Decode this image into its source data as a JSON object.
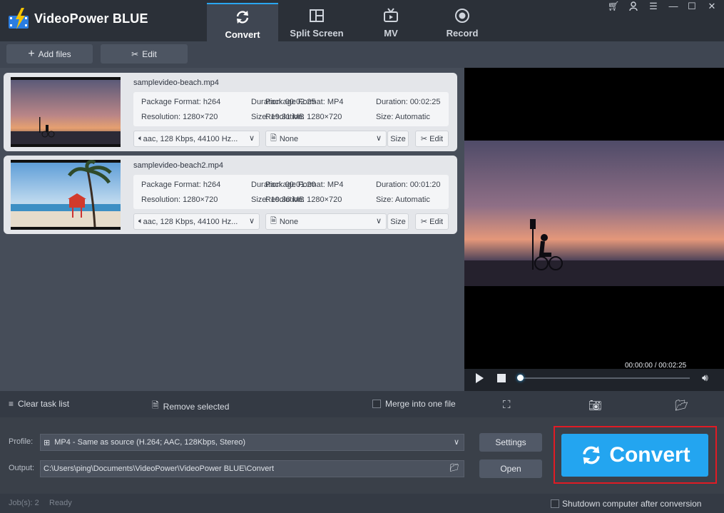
{
  "app": {
    "title": "VideoPower BLUE"
  },
  "tabs": [
    {
      "label": "Convert",
      "icon": "refresh-icon",
      "active": true
    },
    {
      "label": "Split Screen",
      "icon": "split-screen-icon",
      "active": false
    },
    {
      "label": "MV",
      "icon": "tv-icon",
      "active": false
    },
    {
      "label": "Record",
      "icon": "record-icon",
      "active": false
    }
  ],
  "toolbar": {
    "add_files": "Add files",
    "edit": "Edit"
  },
  "files": [
    {
      "name": "samplevideo-beach.mp4",
      "package_format": "Package Format: h264",
      "duration_overlap": "Duration: 00:02:25",
      "output_format": "Package Format: MP4",
      "duration": "Duration: 00:02:25",
      "resolution": "Resolution: 1280×720",
      "size_overlap": "Size: 19.31 MB",
      "output_resolution": "Resolution: 1280×720",
      "size": "Size: Automatic",
      "audio": "aac, 128 Kbps, 44100 Hz...",
      "subtitle": "None",
      "size_btn": "Size",
      "edit_btn": "Edit"
    },
    {
      "name": "samplevideo-beach2.mp4",
      "package_format": "Package Format: h264",
      "duration_overlap": "Duration: 00:01:20",
      "output_format": "Package Format: MP4",
      "duration": "Duration: 00:01:20",
      "resolution": "Resolution: 1280×720",
      "size_overlap": "Size: 10.36 MB",
      "output_resolution": "Resolution: 1280×720",
      "size": "Size: Automatic",
      "audio": "aac, 128 Kbps, 44100 Hz...",
      "subtitle": "None",
      "size_btn": "Size",
      "edit_btn": "Edit"
    }
  ],
  "player": {
    "time": "00:00:00 / 00:02:25",
    "progress": 0.0
  },
  "strip": {
    "clear": "Clear task list",
    "remove": "Remove selected",
    "merge": "Merge into one file"
  },
  "profile": {
    "label": "Profile:",
    "value": "MP4 - Same as source (H.264; AAC, 128Kbps, Stereo)",
    "settings": "Settings"
  },
  "output": {
    "label": "Output:",
    "value": "C:\\Users\\ping\\Documents\\VideoPower\\VideoPower BLUE\\Convert",
    "open": "Open"
  },
  "convert": {
    "label": "Convert"
  },
  "status": {
    "jobs": "Job(s): 2",
    "state": "Ready",
    "shutdown": "Shutdown computer after conversion"
  },
  "colors": {
    "accent": "#23a5f0",
    "highlight": "#e01b24"
  }
}
